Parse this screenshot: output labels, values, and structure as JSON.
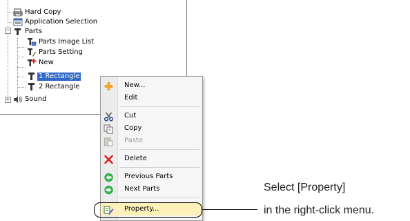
{
  "tree": {
    "items": [
      {
        "label": "Hard Copy",
        "icon": "hard-copy-icon"
      },
      {
        "label": "Application Selection",
        "icon": "application-selection-icon"
      },
      {
        "label": "Parts",
        "icon": "parts-folder-icon"
      },
      {
        "label": "Parts Image List",
        "icon": "parts-image-list-icon"
      },
      {
        "label": "Parts Setting",
        "icon": "parts-setting-icon"
      },
      {
        "label": "New",
        "icon": "new-part-icon"
      },
      {
        "label": "1 Rectangle",
        "icon": "part-icon"
      },
      {
        "label": "2 Rectangle",
        "icon": "part-icon"
      },
      {
        "label": "Sound",
        "icon": "speaker-icon"
      }
    ]
  },
  "context_menu": {
    "items": [
      {
        "label": "New...",
        "icon": "plus-icon",
        "enabled": true
      },
      {
        "label": "Edit",
        "enabled": true
      },
      {
        "label": "Cut",
        "icon": "scissors-icon",
        "enabled": true
      },
      {
        "label": "Copy",
        "icon": "copy-icon",
        "enabled": true
      },
      {
        "label": "Paste",
        "icon": "paste-icon",
        "enabled": false
      },
      {
        "label": "Delete",
        "icon": "delete-x-icon",
        "enabled": true
      },
      {
        "label": "Previous Parts",
        "icon": "previous-arrow-icon",
        "enabled": true
      },
      {
        "label": "Next Parts",
        "icon": "next-arrow-icon",
        "enabled": true
      },
      {
        "label": "Property...",
        "icon": "property-icon",
        "enabled": true,
        "highlighted": true
      }
    ]
  },
  "callout": {
    "line1": "Select [Property]",
    "line2": "in the right-click menu."
  },
  "colors": {
    "selection": "#3169c6",
    "highlight": "#fdf0b8",
    "delete_red": "#e02020",
    "arrow_green": "#2db04a",
    "plus_orange": "#f5a623"
  }
}
